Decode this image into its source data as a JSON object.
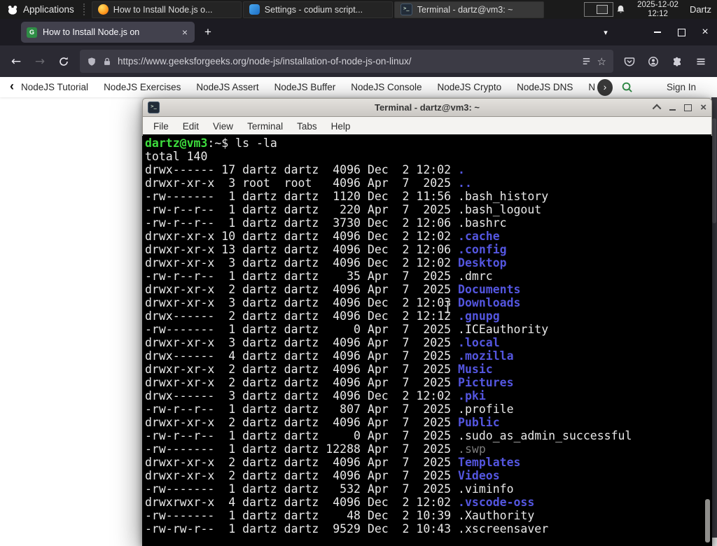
{
  "panel": {
    "applications_label": "Applications",
    "windows": [
      {
        "label": "How to Install Node.js o...",
        "icon": "firefox-icon"
      },
      {
        "label": "Settings - codium script...",
        "icon": "codium-icon"
      },
      {
        "label": "Terminal - dartz@vm3: ~",
        "icon": "terminal-icon"
      }
    ],
    "clock": {
      "date": "2025-12-02",
      "time": "12:12"
    },
    "user_label": "Dartz"
  },
  "browser": {
    "tab_title": "How to Install Node.js on",
    "url": "https://www.geeksforgeeks.org/node-js/installation-of-node-js-on-linux/",
    "site_nav": {
      "items": [
        "NodeJS Tutorial",
        "NodeJS Exercises",
        "NodeJS Assert",
        "NodeJS Buffer",
        "NodeJS Console",
        "NodeJS Crypto",
        "NodeJS DNS",
        "Node"
      ],
      "sign_in_label": "Sign In"
    }
  },
  "terminal": {
    "title": "Terminal - dartz@vm3: ~",
    "menu": [
      "File",
      "Edit",
      "View",
      "Terminal",
      "Tabs",
      "Help"
    ],
    "prompt_user_host": "dartz@vm3",
    "prompt_separator": ":~$",
    "command": " ls -la",
    "total_line": "total 140",
    "listing": [
      {
        "meta": "drwx------ 17 dartz dartz  4096 Dec  2 12:02 ",
        "name": ".",
        "type": "dir"
      },
      {
        "meta": "drwxr-xr-x  3 root  root   4096 Apr  7  2025 ",
        "name": "..",
        "type": "dir"
      },
      {
        "meta": "-rw-------  1 dartz dartz  1120 Dec  2 11:56 ",
        "name": ".bash_history",
        "type": "file"
      },
      {
        "meta": "-rw-r--r--  1 dartz dartz   220 Apr  7  2025 ",
        "name": ".bash_logout",
        "type": "file"
      },
      {
        "meta": "-rw-r--r--  1 dartz dartz  3730 Dec  2 12:06 ",
        "name": ".bashrc",
        "type": "file"
      },
      {
        "meta": "drwxr-xr-x 10 dartz dartz  4096 Dec  2 12:02 ",
        "name": ".cache",
        "type": "dir"
      },
      {
        "meta": "drwxr-xr-x 13 dartz dartz  4096 Dec  2 12:06 ",
        "name": ".config",
        "type": "dir"
      },
      {
        "meta": "drwxr-xr-x  3 dartz dartz  4096 Dec  2 12:02 ",
        "name": "Desktop",
        "type": "dir"
      },
      {
        "meta": "-rw-r--r--  1 dartz dartz    35 Apr  7  2025 ",
        "name": ".dmrc",
        "type": "file"
      },
      {
        "meta": "drwxr-xr-x  2 dartz dartz  4096 Apr  7  2025 ",
        "name": "Documents",
        "type": "dir"
      },
      {
        "meta": "drwxr-xr-x  3 dartz dartz  4096 Dec  2 12:03 ",
        "name": "Downloads",
        "type": "dir"
      },
      {
        "meta": "drwx------  2 dartz dartz  4096 Dec  2 12:12 ",
        "name": ".gnupg",
        "type": "dir"
      },
      {
        "meta": "-rw-------  1 dartz dartz     0 Apr  7  2025 ",
        "name": ".ICEauthority",
        "type": "file"
      },
      {
        "meta": "drwxr-xr-x  3 dartz dartz  4096 Apr  7  2025 ",
        "name": ".local",
        "type": "dir"
      },
      {
        "meta": "drwx------  4 dartz dartz  4096 Apr  7  2025 ",
        "name": ".mozilla",
        "type": "dir"
      },
      {
        "meta": "drwxr-xr-x  2 dartz dartz  4096 Apr  7  2025 ",
        "name": "Music",
        "type": "dir"
      },
      {
        "meta": "drwxr-xr-x  2 dartz dartz  4096 Apr  7  2025 ",
        "name": "Pictures",
        "type": "dir"
      },
      {
        "meta": "drwx------  3 dartz dartz  4096 Dec  2 12:02 ",
        "name": ".pki",
        "type": "dir"
      },
      {
        "meta": "-rw-r--r--  1 dartz dartz   807 Apr  7  2025 ",
        "name": ".profile",
        "type": "file"
      },
      {
        "meta": "drwxr-xr-x  2 dartz dartz  4096 Apr  7  2025 ",
        "name": "Public",
        "type": "dir"
      },
      {
        "meta": "-rw-r--r--  1 dartz dartz     0 Apr  7  2025 ",
        "name": ".sudo_as_admin_successful",
        "type": "file"
      },
      {
        "meta": "-rw-------  1 dartz dartz 12288 Apr  7  2025 ",
        "name": ".swp",
        "type": "dim"
      },
      {
        "meta": "drwxr-xr-x  2 dartz dartz  4096 Apr  7  2025 ",
        "name": "Templates",
        "type": "dir"
      },
      {
        "meta": "drwxr-xr-x  2 dartz dartz  4096 Apr  7  2025 ",
        "name": "Videos",
        "type": "dir"
      },
      {
        "meta": "-rw-------  1 dartz dartz   532 Apr  7  2025 ",
        "name": ".viminfo",
        "type": "file"
      },
      {
        "meta": "drwxrwxr-x  4 dartz dartz  4096 Dec  2 12:02 ",
        "name": ".vscode-oss",
        "type": "dir"
      },
      {
        "meta": "-rw-------  1 dartz dartz    48 Dec  2 10:39 ",
        "name": ".Xauthority",
        "type": "file"
      },
      {
        "meta": "-rw-rw-r--  1 dartz dartz  9529 Dec  2 10:43 ",
        "name": ".xscreensaver",
        "type": "file"
      }
    ]
  },
  "glyphs": {
    "close": "×",
    "plus": "+",
    "list_tabs": "▾",
    "back": "←",
    "forward": "→",
    "star": "☆",
    "prev": "‹",
    "next": "›"
  },
  "colors": {
    "terminal_green": "#3ddd3d",
    "terminal_blue": "#5456e0",
    "terminal_dim": "#7c7c7c",
    "gfg_green": "#2f8d46"
  }
}
